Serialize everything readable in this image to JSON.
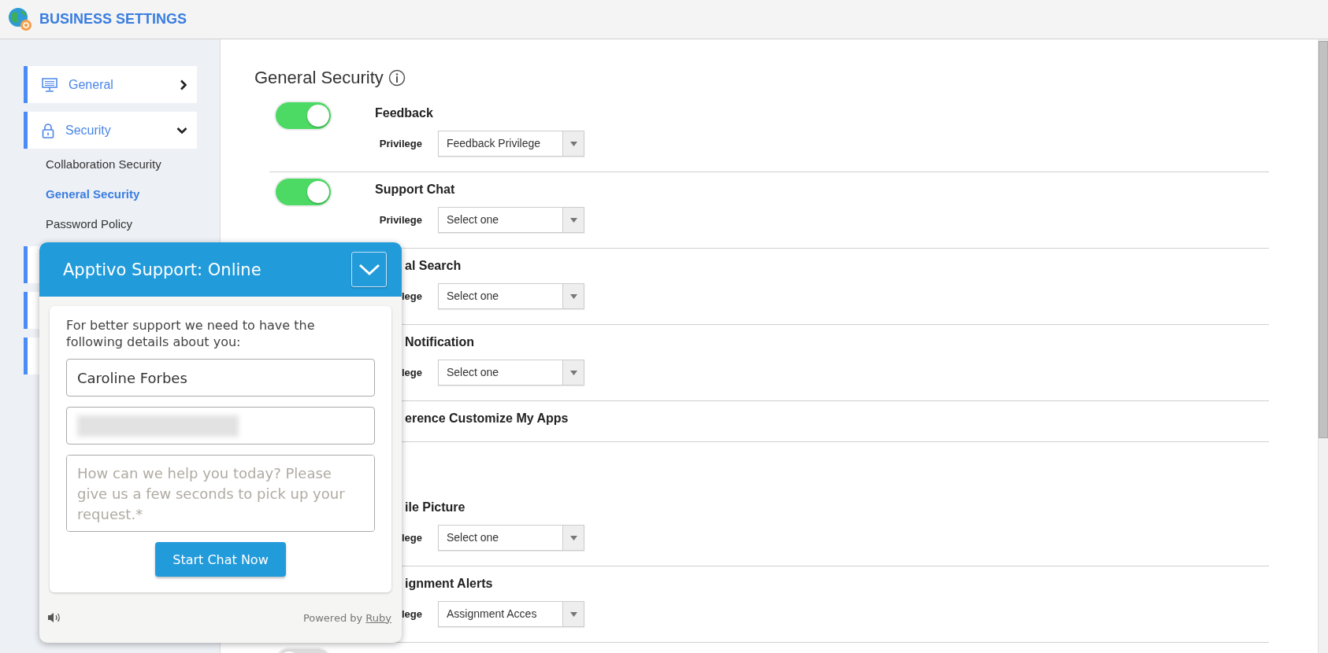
{
  "header": {
    "title": "BUSINESS SETTINGS"
  },
  "sidebar": {
    "items": [
      {
        "label": "General",
        "expanded": false
      },
      {
        "label": "Security",
        "expanded": true,
        "children": [
          {
            "label": "Collaboration Security",
            "selected": false
          },
          {
            "label": "General Security",
            "selected": true
          },
          {
            "label": "Password Policy",
            "selected": false
          }
        ]
      }
    ]
  },
  "main": {
    "heading": "General Security",
    "rows": [
      {
        "covered": false,
        "on": true,
        "title": "Feedback",
        "privilege_label": "Privilege",
        "privilege": "Feedback Privilege"
      },
      {
        "covered": false,
        "on": true,
        "title": "Support Chat",
        "privilege_label": "Privilege",
        "privilege": "Select one"
      },
      {
        "covered": true,
        "title": "al Search",
        "privilege_label": "lege",
        "privilege": "Select one"
      },
      {
        "covered": true,
        "title": "Notification",
        "privilege_label": "lege",
        "privilege": "Select one"
      },
      {
        "covered": true,
        "title": "erence Customize My Apps"
      },
      {
        "covered": true,
        "title": "ile Picture",
        "privilege_label": "lege",
        "privilege": "Select one"
      },
      {
        "covered": true,
        "title": "ignment Alerts",
        "privilege_label": "lege",
        "privilege": "Assignment Acces"
      },
      {
        "covered": false,
        "on": false
      }
    ]
  },
  "chat": {
    "title": "Apptivo Support: Online",
    "intro": "For better support we need to have the following details about you:",
    "name_value": "Caroline Forbes",
    "message_placeholder": "How can we help you today? Please give us a few seconds to pick up your request.*",
    "button": "Start Chat Now",
    "powered_by": "Powered by",
    "link": "Ruby"
  }
}
